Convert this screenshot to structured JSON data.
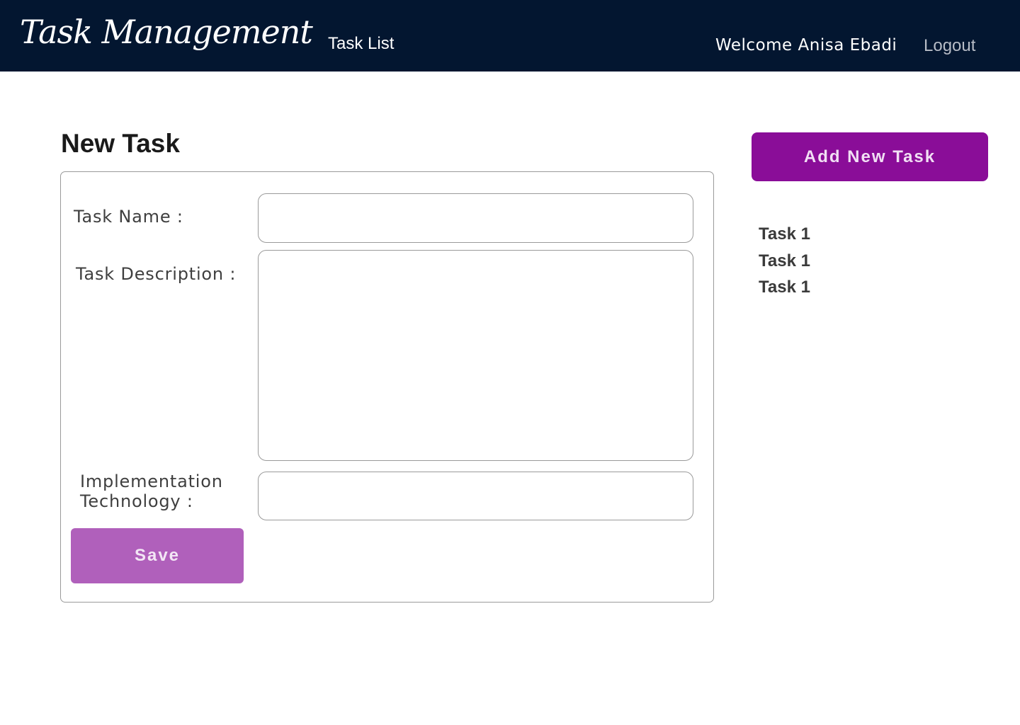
{
  "header": {
    "brand": "Task Management",
    "nav_task_list": "Task List",
    "welcome": "Welcome Anisa Ebadi",
    "logout": "Logout"
  },
  "main": {
    "title": "New Task",
    "form": {
      "task_name_label": "Task Name :",
      "task_name_value": "",
      "task_description_label": "Task Description :",
      "task_description_value": "",
      "implementation_label_line1": "Implementation",
      "implementation_label_line2": "Technology :",
      "implementation_value": "",
      "save_label": "Save"
    }
  },
  "sidebar": {
    "add_task_label": "Add New Task",
    "tasks": [
      {
        "label": "Task 1"
      },
      {
        "label": "Task 1"
      },
      {
        "label": "Task 1"
      }
    ]
  },
  "colors": {
    "header_bg": "#031630",
    "add_button_bg": "#8a0d98",
    "save_button_bg": "#b060bb"
  }
}
